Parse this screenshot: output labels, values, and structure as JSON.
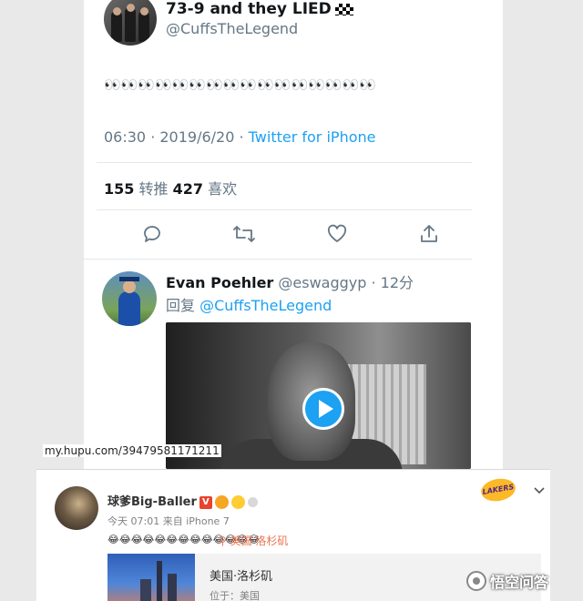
{
  "tweet": {
    "display_name": "73-9 and they LIED",
    "handle": "@CuffsTheLegend",
    "body": "👀👀👀👀👀👀👀👀👀👀👀👀👀👀👀👀",
    "time": "06:30 · 2019/6/20 · ",
    "source": "Twitter for iPhone",
    "retweets_count": "155",
    "retweets_label": " 转推 ",
    "likes_count": "427",
    "likes_label": " 喜欢"
  },
  "reply": {
    "display_name": "Evan Poehler",
    "handle_time": " @eswaggyp · 12分",
    "to_prefix": "回复 ",
    "to_handle": "@CuffsTheLegend"
  },
  "video_url_overlay": "my.hupu.com/39479581171211",
  "weibo": {
    "user_name": "球爹Big-Baller",
    "v_badge": "V",
    "time_source": "今天 07:01 来自 iPhone 7",
    "body": "😂😂😂😂😂😂😂😂😂😂😂😂😂",
    "location_link": "美国·洛杉矶",
    "team_logo_text": "LAKERS",
    "location_card": {
      "title": "美国·洛杉矶",
      "subtitle": "位于：美国"
    }
  },
  "watermark": "悟空问答",
  "colors": {
    "twitter_blue": "#1da1f2",
    "weibo_orange": "#eb7350",
    "weibo_red_v": "#e8432d"
  }
}
